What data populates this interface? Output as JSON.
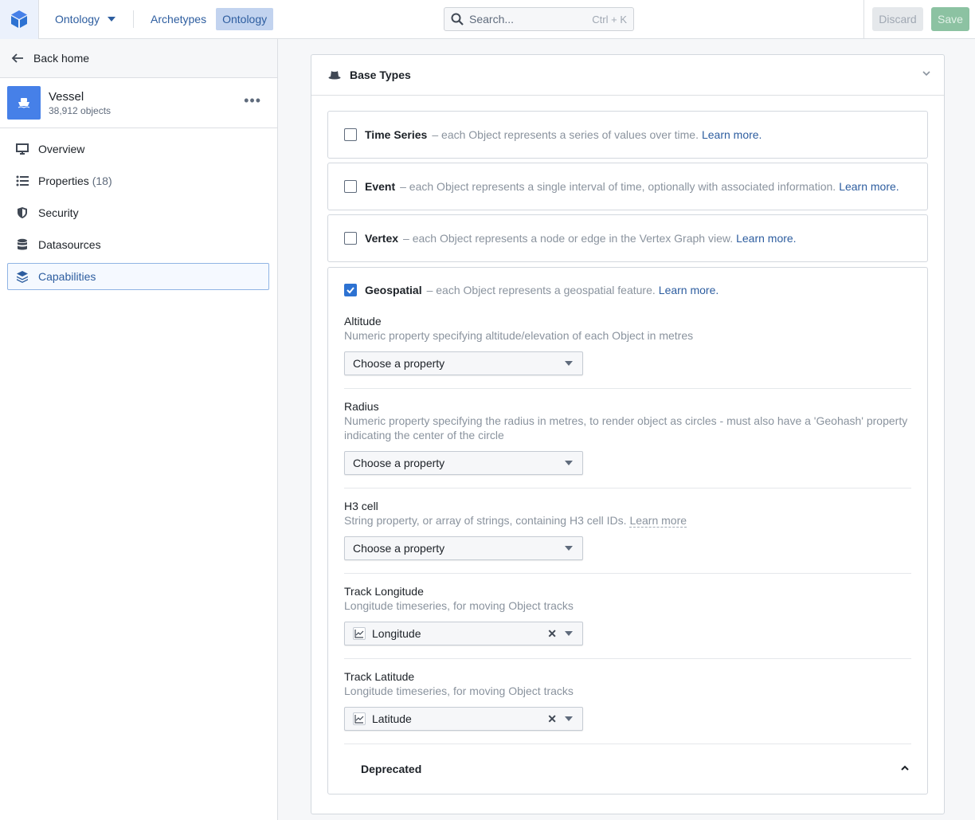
{
  "topbar": {
    "app_menu_label": "Ontology",
    "tabs": [
      {
        "label": "Archetypes",
        "active": false
      },
      {
        "label": "Ontology",
        "active": true
      }
    ],
    "search": {
      "placeholder": "Search...",
      "shortcut": "Ctrl + K"
    },
    "discard_label": "Discard",
    "save_label": "Save"
  },
  "sidebar": {
    "back_label": "Back home",
    "object": {
      "name": "Vessel",
      "count": "38,912 objects",
      "icon": "ship-icon",
      "color": "#4680e8"
    },
    "items": [
      {
        "label": "Overview",
        "count": "",
        "icon": "desktop-icon",
        "active": false
      },
      {
        "label": "Properties",
        "count": "(18)",
        "icon": "list-icon",
        "active": false
      },
      {
        "label": "Security",
        "count": "",
        "icon": "shield-icon",
        "active": false
      },
      {
        "label": "Datasources",
        "count": "",
        "icon": "database-icon",
        "active": false
      },
      {
        "label": "Capabilities",
        "count": "",
        "icon": "layers-icon",
        "active": true
      }
    ]
  },
  "main": {
    "section_title": "Base Types",
    "base_types": [
      {
        "name": "Time Series",
        "desc": "– each Object represents a series of values over time.",
        "link": "Learn more.",
        "checked": false
      },
      {
        "name": "Event",
        "desc": "– each Object represents a single interval of time, optionally with associated information.",
        "link": "Learn more.",
        "checked": false
      },
      {
        "name": "Vertex",
        "desc": "– each Object represents a node or edge in the Vertex Graph view.",
        "link": "Learn more.",
        "checked": false
      },
      {
        "name": "Geospatial",
        "desc": "– each Object represents a geospatial feature.",
        "link": "Learn more.",
        "checked": true
      }
    ],
    "geo_fields": [
      {
        "label": "Altitude",
        "desc": "Numeric property specifying altitude/elevation of each Object in metres",
        "value": "Choose a property",
        "selected": false
      },
      {
        "label": "Radius",
        "desc": "Numeric property specifying the radius in metres, to render object as circles - must also have a 'Geohash' property indicating the center of the circle",
        "value": "Choose a property",
        "selected": false
      },
      {
        "label": "H3 cell",
        "desc": "String property, or array of strings, containing H3 cell IDs.",
        "link": "Learn more",
        "value": "Choose a property",
        "selected": false
      },
      {
        "label": "Track Longitude",
        "desc": "Longitude timeseries, for moving Object tracks",
        "value": "Longitude",
        "selected": true
      },
      {
        "label": "Track Latitude",
        "desc": "Longitude timeseries, for moving Object tracks",
        "value": "Latitude",
        "selected": true
      }
    ],
    "deprecated_label": "Deprecated"
  },
  "colors": {
    "accent": "#2d72d2",
    "link": "#2d5d9f",
    "save": "#8cc2a2",
    "active_tab": "#c2d3ef"
  }
}
